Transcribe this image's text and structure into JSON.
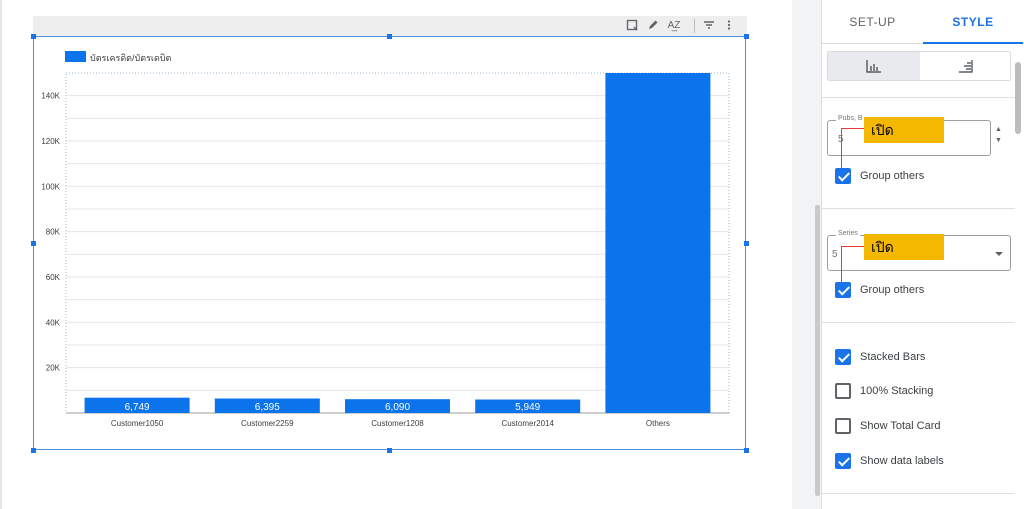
{
  "toolbar": {
    "icons": [
      "select-icon",
      "pencil-icon",
      "sort-az-icon",
      "filter-icon",
      "more-vert-icon"
    ]
  },
  "chart_data": {
    "type": "bar",
    "legend": {
      "label": "บัตรเครดิต/บัตรเดบิต",
      "color": "#0b73eb",
      "position": "top-left"
    },
    "categories": [
      "Customer1050",
      "Customer2259",
      "Customer1208",
      "Customer2014",
      "Others"
    ],
    "series": [
      {
        "name": "บัตรเครดิต/บัตรเดบิต",
        "values": [
          6749,
          6395,
          6090,
          5949,
          150000
        ],
        "data_labels": [
          "6,749",
          "6,395",
          "6,090",
          "5,949",
          ""
        ]
      }
    ],
    "ylim": [
      0,
      150000
    ],
    "y_ticks": [
      20000,
      40000,
      60000,
      80000,
      100000,
      120000,
      140000
    ],
    "y_tick_labels": [
      "20K",
      "40K",
      "60K",
      "80K",
      "100K",
      "120K",
      "140K"
    ],
    "grid": true,
    "bar_color": "#0b73eb"
  },
  "panel": {
    "tabs": [
      {
        "label": "SET-UP",
        "active": false
      },
      {
        "label": "STYLE",
        "active": true
      }
    ],
    "toggle_icons": [
      "bar-chart-vertical-icon",
      "bar-chart-horizontal-icon"
    ],
    "bars_field": {
      "label": "Pubs, B",
      "value": "5"
    },
    "series_field": {
      "label": "Series",
      "value": "5"
    },
    "callout_1": "เปิด",
    "callout_2": "เปิด",
    "checkboxes": [
      {
        "label": "Group others",
        "checked": true
      },
      {
        "label": "Group others",
        "checked": true
      },
      {
        "label": "Stacked Bars",
        "checked": true
      },
      {
        "label": "100% Stacking",
        "checked": false
      },
      {
        "label": "Show Total Card",
        "checked": false
      },
      {
        "label": "Show data labels",
        "checked": true
      }
    ]
  }
}
